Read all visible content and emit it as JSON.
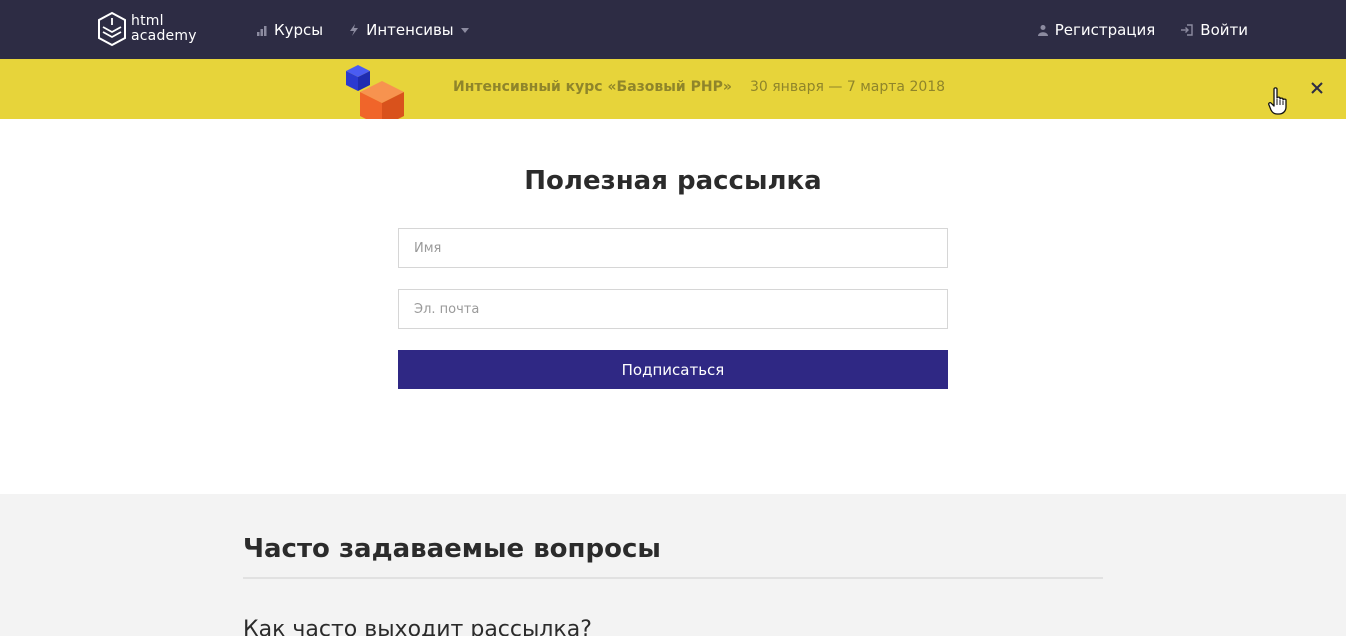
{
  "header": {
    "logo": {
      "line1": "html",
      "line2": "academy"
    },
    "nav_left": [
      {
        "label": "Курсы",
        "icon": "bar-chart-icon"
      },
      {
        "label": "Интенсивы",
        "icon": "lightning-icon"
      }
    ],
    "nav_right": [
      {
        "label": "Регистрация",
        "icon": "user-icon"
      },
      {
        "label": "Войти",
        "icon": "sign-in-icon"
      }
    ]
  },
  "promo": {
    "title": "Интенсивный курс «Базовый PHP»",
    "dates": "30 января — 7 марта 2018",
    "close_icon": "close-icon"
  },
  "subscribe": {
    "title": "Полезная рассылка",
    "name_placeholder": "Имя",
    "email_placeholder": "Эл. почта",
    "submit_label": "Подписаться"
  },
  "faq": {
    "title": "Часто задаваемые вопросы",
    "questions": [
      "Как часто выходит рассылка?"
    ]
  },
  "colors": {
    "header_bg": "#2d2c44",
    "promo_bg": "#e7d43a",
    "button_bg": "#2f2884"
  }
}
